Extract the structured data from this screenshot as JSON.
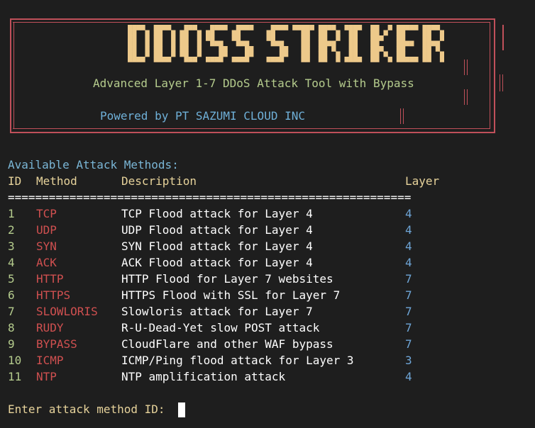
{
  "banner": {
    "title": "DDOSS STRIKER",
    "subtitle": "Advanced Layer 1-7 DDoS Attack Tool with Bypass",
    "powered_by": "Powered by PT SAZUMI CLOUD INC"
  },
  "menu": {
    "heading": "Available Attack Methods:",
    "columns": {
      "id": "ID",
      "method": "Method",
      "description": "Description",
      "layer": "Layer"
    },
    "separator": "===========================================================",
    "rows": [
      {
        "id": "1",
        "method": "TCP",
        "description": "TCP Flood attack for Layer 4",
        "layer": "4"
      },
      {
        "id": "2",
        "method": "UDP",
        "description": "UDP Flood attack for Layer 4",
        "layer": "4"
      },
      {
        "id": "3",
        "method": "SYN",
        "description": "SYN Flood attack for Layer 4",
        "layer": "4"
      },
      {
        "id": "4",
        "method": "ACK",
        "description": "ACK Flood attack for Layer 4",
        "layer": "4"
      },
      {
        "id": "5",
        "method": "HTTP",
        "description": "HTTP Flood for Layer 7 websites",
        "layer": "7"
      },
      {
        "id": "6",
        "method": "HTTPS",
        "description": "HTTPS Flood with SSL for Layer 7",
        "layer": "7"
      },
      {
        "id": "7",
        "method": "SLOWLORIS",
        "description": "Slowloris attack for Layer 7",
        "layer": "7"
      },
      {
        "id": "8",
        "method": "RUDY",
        "description": "R-U-Dead-Yet slow POST attack",
        "layer": "7"
      },
      {
        "id": "9",
        "method": "BYPASS",
        "description": "CloudFlare and other WAF bypass",
        "layer": "7"
      },
      {
        "id": "10",
        "method": "ICMP",
        "description": "ICMP/Ping flood attack for Layer 3",
        "layer": "3"
      },
      {
        "id": "11",
        "method": "NTP",
        "description": "NTP amplification attack",
        "layer": "4"
      }
    ]
  },
  "prompt": {
    "label": "Enter attack method ID: ",
    "value": ""
  },
  "colors": {
    "background": "#1e1e1e",
    "frame": "#c0505a",
    "title": "#edc98a",
    "subtitle": "#b5cc8d",
    "powered": "#6fb0d8",
    "header": "#e7d39b",
    "method": "#d05050",
    "layer": "#6fa6d8"
  }
}
